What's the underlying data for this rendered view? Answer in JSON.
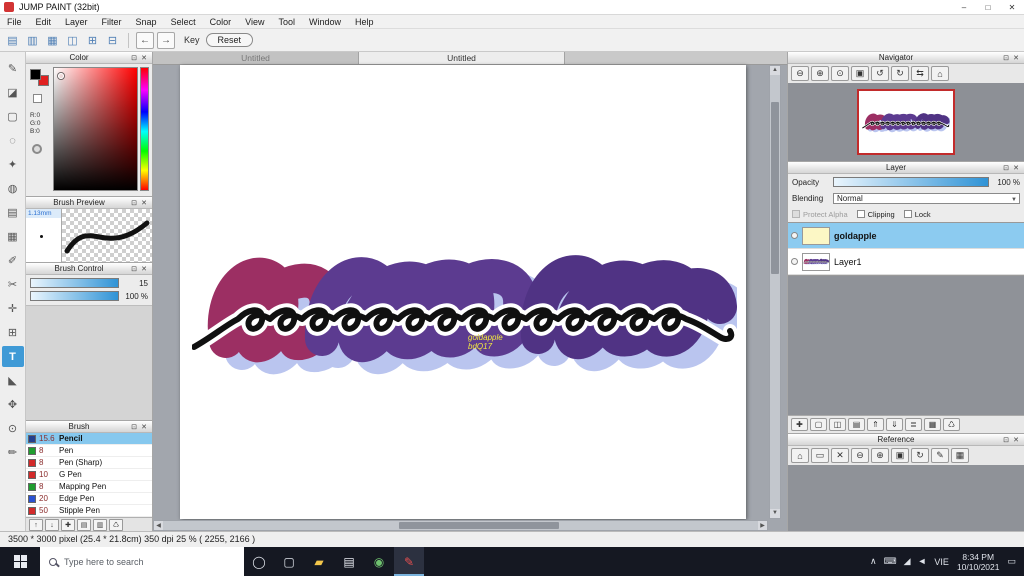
{
  "window": {
    "title": "JUMP PAINT (32bit)",
    "controls": {
      "minimize": "–",
      "maximize": "□",
      "close": "✕"
    }
  },
  "menu": {
    "items": [
      "File",
      "Edit",
      "Layer",
      "Filter",
      "Snap",
      "Select",
      "Color",
      "View",
      "Tool",
      "Window",
      "Help"
    ]
  },
  "toolbar": {
    "icons": [
      {
        "name": "new-canvas-icon",
        "glyph": "▤"
      },
      {
        "name": "open-file-icon",
        "glyph": "▥"
      },
      {
        "name": "save-icon",
        "glyph": "▦"
      },
      {
        "name": "brush-settings-icon",
        "glyph": "◫"
      },
      {
        "name": "materials-icon",
        "glyph": "⊞"
      },
      {
        "name": "snap-settings-icon",
        "glyph": "⊟"
      }
    ],
    "undo": "←",
    "redo": "→",
    "key_label": "Key",
    "reset_label": "Reset"
  },
  "tools": [
    {
      "name": "brush-tool",
      "glyph": "✎"
    },
    {
      "name": "eraser-tool",
      "glyph": "◪"
    },
    {
      "name": "marquee-select-tool",
      "glyph": "▢"
    },
    {
      "name": "lasso-tool",
      "glyph": "◌"
    },
    {
      "name": "magic-wand-tool",
      "glyph": "✦"
    },
    {
      "name": "bucket-fill-tool",
      "glyph": "◍"
    },
    {
      "name": "gradient-tool",
      "glyph": "▤"
    },
    {
      "name": "screentone-tool",
      "glyph": "▦"
    },
    {
      "name": "select-pen-tool",
      "glyph": "✐"
    },
    {
      "name": "divide-tool",
      "glyph": "✂"
    },
    {
      "name": "move-tool",
      "glyph": "✛"
    },
    {
      "name": "grid-tool",
      "glyph": "⊞"
    },
    {
      "name": "text-tool",
      "glyph": "T",
      "selected": true
    },
    {
      "name": "eyedropper-tool",
      "glyph": "◣"
    },
    {
      "name": "hand-tool",
      "glyph": "✥"
    },
    {
      "name": "zoom-tool",
      "glyph": "⊙"
    },
    {
      "name": "pencil-tool",
      "glyph": "✏"
    }
  ],
  "tabs": [
    {
      "label": "Untitled"
    },
    {
      "label": "Untitled",
      "selected": true
    }
  ],
  "canvas": {
    "watermark_line1": "goldapple",
    "watermark_line2": "bdQ17"
  },
  "panels": {
    "color": {
      "title": "Color",
      "r": "R:0",
      "g": "G:0",
      "b": "B:0"
    },
    "brush_preview": {
      "title": "Brush Preview",
      "size_label": "1.13mm"
    },
    "brush_control": {
      "title": "Brush Control",
      "rows": [
        {
          "value": "15"
        },
        {
          "value": "100 %"
        }
      ]
    },
    "brush": {
      "title": "Brush",
      "items": [
        {
          "size": "15.6",
          "name": "Pencil",
          "color": "#24408e",
          "selected": true
        },
        {
          "size": "8",
          "name": "Pen",
          "color": "#1f9d2f"
        },
        {
          "size": "8",
          "name": "Pen (Sharp)",
          "color": "#d22a2a"
        },
        {
          "size": "10",
          "name": "G Pen",
          "color": "#d22a2a"
        },
        {
          "size": "8",
          "name": "Mapping Pen",
          "color": "#1f9d2f"
        },
        {
          "size": "20",
          "name": "Edge Pen",
          "color": "#2a52d2"
        },
        {
          "size": "50",
          "name": "Stipple Pen",
          "color": "#d22a2a"
        }
      ],
      "buttons": [
        {
          "name": "brush-up-icon",
          "glyph": "↑"
        },
        {
          "name": "brush-down-icon",
          "glyph": "↓"
        },
        {
          "name": "brush-add-icon",
          "glyph": "✚"
        },
        {
          "name": "brush-folder-icon",
          "glyph": "▤"
        },
        {
          "name": "brush-edit-icon",
          "glyph": "▥"
        },
        {
          "name": "brush-delete-icon",
          "glyph": "♺"
        }
      ]
    },
    "navigator": {
      "title": "Navigator",
      "buttons": [
        {
          "name": "nav-zoom-out-icon",
          "glyph": "⊖"
        },
        {
          "name": "nav-zoom-in-icon",
          "glyph": "⊕"
        },
        {
          "name": "nav-fit-icon",
          "glyph": "⊙"
        },
        {
          "name": "nav-actual-size-icon",
          "glyph": "▣"
        },
        {
          "name": "nav-rotate-left-icon",
          "glyph": "↺"
        },
        {
          "name": "nav-rotate-right-icon",
          "glyph": "↻"
        },
        {
          "name": "nav-flip-icon",
          "glyph": "⇆"
        },
        {
          "name": "nav-reset-icon",
          "glyph": "⌂"
        }
      ]
    },
    "layer": {
      "title": "Layer",
      "opacity_label": "Opacity",
      "opacity_value": "100 %",
      "blending_label": "Blending",
      "blending_value": "Normal",
      "protect_alpha_label": "Protect Alpha",
      "clipping_label": "Clipping",
      "lock_label": "Lock",
      "layers": [
        {
          "name": "goldapple",
          "selected": true
        },
        {
          "name": "Layer1"
        }
      ],
      "buttons": [
        {
          "name": "layer-add-icon",
          "glyph": "✚"
        },
        {
          "name": "layer-new-icon",
          "glyph": "▢"
        },
        {
          "name": "layer-duplicate-icon",
          "glyph": "◫"
        },
        {
          "name": "layer-folder-icon",
          "glyph": "▤"
        },
        {
          "name": "layer-move-up-icon",
          "glyph": "⇑"
        },
        {
          "name": "layer-move-down-icon",
          "glyph": "⇓"
        },
        {
          "name": "layer-merge-icon",
          "glyph": "≣"
        },
        {
          "name": "layer-settings-icon",
          "glyph": "▦"
        },
        {
          "name": "layer-delete-icon",
          "glyph": "♺"
        }
      ]
    },
    "reference": {
      "title": "Reference",
      "buttons": [
        {
          "name": "ref-home-icon",
          "glyph": "⌂"
        },
        {
          "name": "ref-open-icon",
          "glyph": "▭"
        },
        {
          "name": "ref-close-icon",
          "glyph": "✕"
        },
        {
          "name": "ref-zoom-out-icon",
          "glyph": "⊖"
        },
        {
          "name": "ref-zoom-in-icon",
          "glyph": "⊕"
        },
        {
          "name": "ref-actual-size-icon",
          "glyph": "▣"
        },
        {
          "name": "ref-rotate-icon",
          "glyph": "↻"
        },
        {
          "name": "ref-pick-icon",
          "glyph": "✎"
        },
        {
          "name": "ref-grid-icon",
          "glyph": "▦"
        }
      ]
    },
    "header_icons": {
      "restore": "⊡",
      "close": "✕"
    }
  },
  "status": {
    "text": "3500 * 3000 pixel   (25.4 * 21.8cm)   350 dpi   25 %    ( 2255, 2166 )"
  },
  "taskbar": {
    "search_placeholder": "Type here to search",
    "apps": [
      {
        "name": "cortana-icon",
        "glyph": "◯",
        "color": "#dfe3ea"
      },
      {
        "name": "task-view-icon",
        "glyph": "▢",
        "color": "#dfe3ea"
      },
      {
        "name": "file-explorer-icon",
        "glyph": "▰",
        "color": "#f2c64b"
      },
      {
        "name": "microsoft-store-icon",
        "glyph": "▤",
        "color": "#e8ebf2"
      },
      {
        "name": "chrome-icon",
        "glyph": "◉",
        "color": "#6fc26f"
      },
      {
        "name": "jump-paint-taskbar-icon",
        "glyph": "✎",
        "color": "#e85050",
        "selected": true
      }
    ],
    "tray_icons": [
      {
        "name": "hidden-icons-chevron",
        "glyph": "∧"
      },
      {
        "name": "touch-keyboard-icon",
        "glyph": "⌨"
      },
      {
        "name": "network-icon",
        "glyph": "◢"
      },
      {
        "name": "volume-icon",
        "glyph": "◄"
      }
    ],
    "language": "VIE",
    "time": "8:34 PM",
    "date": "10/10/2021",
    "notification": "▭"
  }
}
